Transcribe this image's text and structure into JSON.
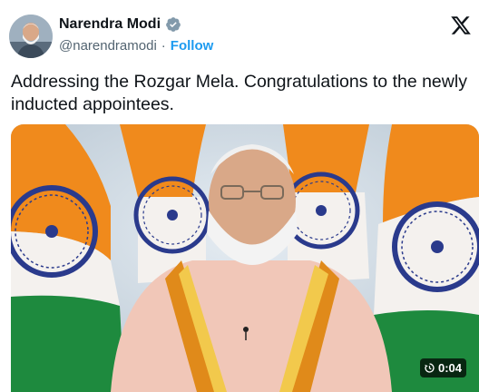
{
  "author": {
    "name": "Narendra Modi",
    "handle": "@narendramodi",
    "separator": "·",
    "follow_label": "Follow",
    "verified": true,
    "avatar_icon": "profile-photo"
  },
  "platform_icon": "x-logo-icon",
  "tweet": {
    "text": "Addressing the Rozgar Mela. Congratulations to the newly inducted appointees."
  },
  "media": {
    "type": "video",
    "duration": "0:04",
    "duration_icon": "replay-timer-icon"
  },
  "colors": {
    "accent": "#1d9bf0",
    "saffron": "#f08a1c",
    "green": "#1e8a3e",
    "chakra": "#2a3a8c",
    "text_secondary": "#536471"
  }
}
